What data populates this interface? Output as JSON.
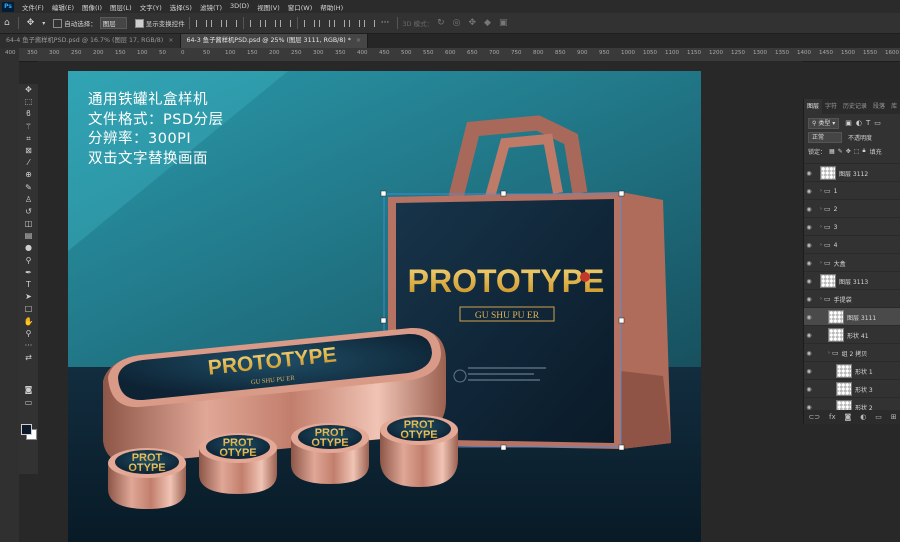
{
  "app": {
    "logo": "Ps"
  },
  "menu": [
    "文件(F)",
    "编辑(E)",
    "图像(I)",
    "图层(L)",
    "文字(Y)",
    "选择(S)",
    "滤镜(T)",
    "3D(D)",
    "视图(V)",
    "窗口(W)",
    "帮助(H)"
  ],
  "options": {
    "auto_select_label": "自动选择：",
    "auto_select_value": "图层",
    "show_transform_label": "显示变换控件",
    "mode_3d_label": "3D 模式："
  },
  "tabs": [
    {
      "label": "64-4 鱼子酱样机PSD.psd @ 16.7% (图层 17, RGB/8)",
      "close": "×"
    },
    {
      "label": "64-3 鱼子酱样机PSD.psd @ 25% (图层 3111, RGB/8) *",
      "close": "×"
    }
  ],
  "ruler": [
    "400",
    "350",
    "300",
    "250",
    "200",
    "150",
    "100",
    "50",
    "0",
    "50",
    "100",
    "150",
    "200",
    "250",
    "300",
    "350",
    "400",
    "450",
    "500",
    "550",
    "600",
    "650",
    "700",
    "750",
    "800",
    "850",
    "900",
    "950",
    "1000",
    "1050",
    "1100",
    "1150",
    "1200",
    "1250",
    "1300",
    "1350",
    "1400",
    "1450",
    "1500",
    "1550",
    "1600"
  ],
  "canvas": {
    "intro_lines": [
      "通用铁罐礼盒样机",
      "文件格式：PSD分层",
      "分辨率：300PI",
      "双击文字替换画面"
    ],
    "brand": "PROTOTYPE",
    "brand_split": [
      "PROT",
      "OTYPE"
    ],
    "sub_brand": "GU SHU PU ER",
    "colors": {
      "bg_top": "#23808f",
      "bg_floor": "#0d2535",
      "bag_front": "#0e2335",
      "bag_side": "#b36f5d",
      "tin": "#c98a7a",
      "gold": "#e8b73a"
    }
  },
  "panel": {
    "tabs": [
      "图层",
      "字符",
      "历史记录",
      "段落",
      "库"
    ],
    "kind_label": "类型",
    "blend_mode": "正常",
    "opacity_label": "不透明度",
    "lock_label": "锁定：",
    "fill_label": "填充",
    "layers": [
      {
        "name": "图层 3112",
        "type": "thumb",
        "indent": 0
      },
      {
        "name": "1",
        "type": "folder",
        "indent": 0
      },
      {
        "name": "2",
        "type": "folder",
        "indent": 0
      },
      {
        "name": "3",
        "type": "folder",
        "indent": 0
      },
      {
        "name": "4",
        "type": "folder",
        "indent": 0
      },
      {
        "name": "大盒",
        "type": "folder",
        "indent": 0
      },
      {
        "name": "图层 3113",
        "type": "thumb",
        "indent": 0
      },
      {
        "name": "手提袋",
        "type": "folder",
        "indent": 0
      },
      {
        "name": "图层 3111",
        "type": "thumb",
        "indent": 1,
        "selected": true
      },
      {
        "name": "形状 41",
        "type": "thumb",
        "indent": 1
      },
      {
        "name": "组 2 拷贝",
        "type": "folder",
        "indent": 1
      },
      {
        "name": "形状 1",
        "type": "thumb",
        "indent": 2
      },
      {
        "name": "形状 3",
        "type": "thumb",
        "indent": 2
      },
      {
        "name": "形状 2",
        "type": "thumb",
        "indent": 2
      }
    ]
  }
}
